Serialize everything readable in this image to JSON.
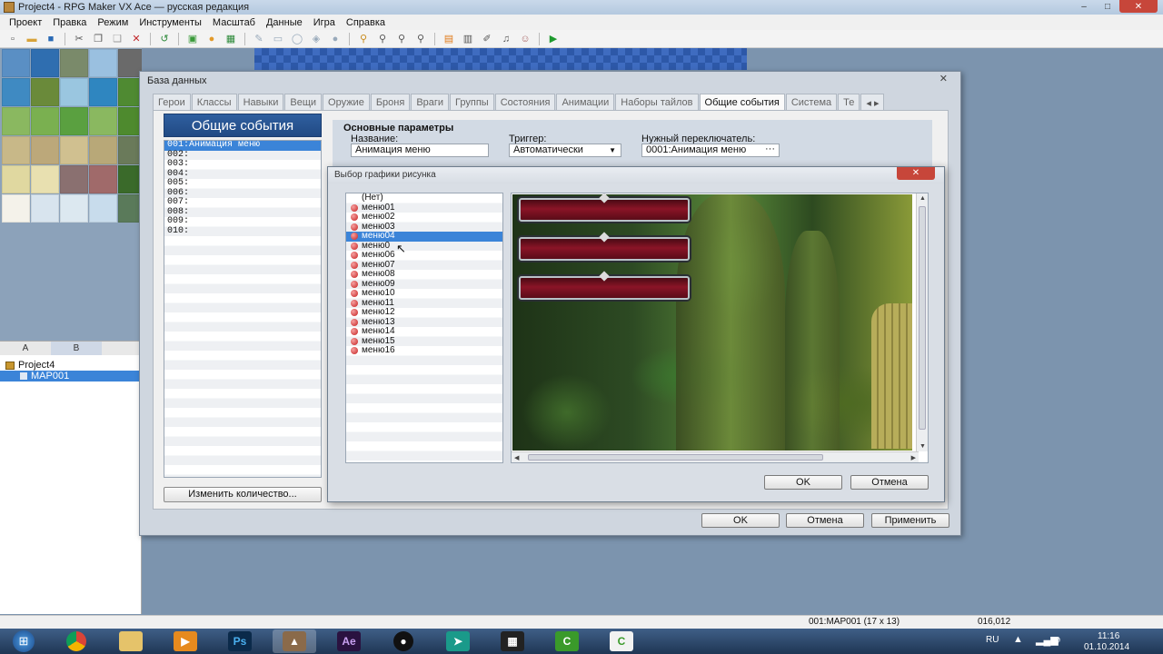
{
  "window": {
    "title": "Project4 - RPG Maker VX Ace — русская редакция",
    "min": "–",
    "max": "□",
    "close": "✕"
  },
  "menu": [
    "Проект",
    "Правка",
    "Режим",
    "Инструменты",
    "Масштаб",
    "Данные",
    "Игра",
    "Справка"
  ],
  "toolbar_icons": [
    {
      "name": "new-project-icon",
      "glyph": "▫",
      "color": "#555"
    },
    {
      "name": "open-project-icon",
      "glyph": "▬",
      "color": "#d8a33a"
    },
    {
      "name": "save-project-icon",
      "glyph": "■",
      "color": "#2a6ab5"
    },
    {
      "name": "cut-icon",
      "glyph": "✂",
      "color": "#555"
    },
    {
      "name": "copy-icon",
      "glyph": "❐",
      "color": "#555"
    },
    {
      "name": "paste-icon",
      "glyph": "❑",
      "color": "#999"
    },
    {
      "name": "delete-icon",
      "glyph": "✕",
      "color": "#c0262a"
    },
    {
      "name": "undo-icon",
      "glyph": "↺",
      "color": "#2d8a3a"
    },
    {
      "name": "map-mode-icon",
      "glyph": "▣",
      "color": "#3a9a3a"
    },
    {
      "name": "event-mode-icon",
      "glyph": "●",
      "color": "#e39a2a"
    },
    {
      "name": "region-mode-icon",
      "glyph": "▦",
      "color": "#2d8a3a"
    },
    {
      "name": "pencil-icon",
      "glyph": "✎",
      "color": "#9ab"
    },
    {
      "name": "rectangle-icon",
      "glyph": "▭",
      "color": "#9ab"
    },
    {
      "name": "ellipse-icon",
      "glyph": "◯",
      "color": "#9ab"
    },
    {
      "name": "fill-icon",
      "glyph": "◈",
      "color": "#9ab"
    },
    {
      "name": "shadow-pen-icon",
      "glyph": "●",
      "color": "#9ab"
    },
    {
      "name": "zoom-1-1-icon",
      "glyph": "⚲",
      "color": "#c88a1a"
    },
    {
      "name": "zoom-1-2-icon",
      "glyph": "⚲",
      "color": "#555"
    },
    {
      "name": "zoom-1-4-icon",
      "glyph": "⚲",
      "color": "#555"
    },
    {
      "name": "zoom-1-8-icon",
      "glyph": "⚲",
      "color": "#555"
    },
    {
      "name": "database-icon",
      "glyph": "▤",
      "color": "#e07b1a"
    },
    {
      "name": "resource-manager-icon",
      "glyph": "▥",
      "color": "#555"
    },
    {
      "name": "script-editor-icon",
      "glyph": "✐",
      "color": "#555"
    },
    {
      "name": "sound-test-icon",
      "glyph": "♫",
      "color": "#555"
    },
    {
      "name": "character-generator-icon",
      "glyph": "☺",
      "color": "#a66"
    },
    {
      "name": "playtest-icon",
      "glyph": "▶",
      "color": "#1e9a2e"
    }
  ],
  "palette_tabs": [
    "A",
    "B"
  ],
  "tree": {
    "project": "Project4",
    "map": "MAP001"
  },
  "status": {
    "map": "001:MAP001 (17 x 13)",
    "coords": "016,012"
  },
  "taskbar": {
    "lang": "RU",
    "time": "11:16",
    "date": "01.10.2014"
  },
  "database": {
    "title": "База данных",
    "close": "✕",
    "tabs": [
      "Герои",
      "Классы",
      "Навыки",
      "Вещи",
      "Оружие",
      "Броня",
      "Враги",
      "Группы",
      "Состояния",
      "Анимации",
      "Наборы тайлов",
      "Общие события",
      "Система",
      "Те"
    ],
    "active_tab": "Общие события",
    "list_header": "Общие события",
    "events": [
      "001:Анимация меню",
      "002:",
      "003:",
      "004:",
      "005:",
      "006:",
      "007:",
      "008:",
      "009:",
      "010:"
    ],
    "change_count_btn": "Изменить количество...",
    "basic": {
      "section": "Основные параметры",
      "name_label": "Название:",
      "name_value": "Анимация меню",
      "trigger_label": "Триггер:",
      "trigger_value": "Автоматически",
      "switch_label": "Нужный переключатель:",
      "switch_value": "0001:Анимация меню"
    },
    "ok": "OK",
    "cancel": "Отмена",
    "apply": "Применить"
  },
  "picker": {
    "title": "Выбор графики рисунка",
    "close": "✕",
    "files": [
      "(Нет)",
      "меню01",
      "меню02",
      "меню03",
      "меню04",
      "меню0",
      "меню06",
      "меню07",
      "меню08",
      "меню09",
      "меню10",
      "меню11",
      "меню12",
      "меню13",
      "меню14",
      "меню15",
      "меню16"
    ],
    "selected": "меню04",
    "ok": "OK",
    "cancel": "Отмена"
  }
}
